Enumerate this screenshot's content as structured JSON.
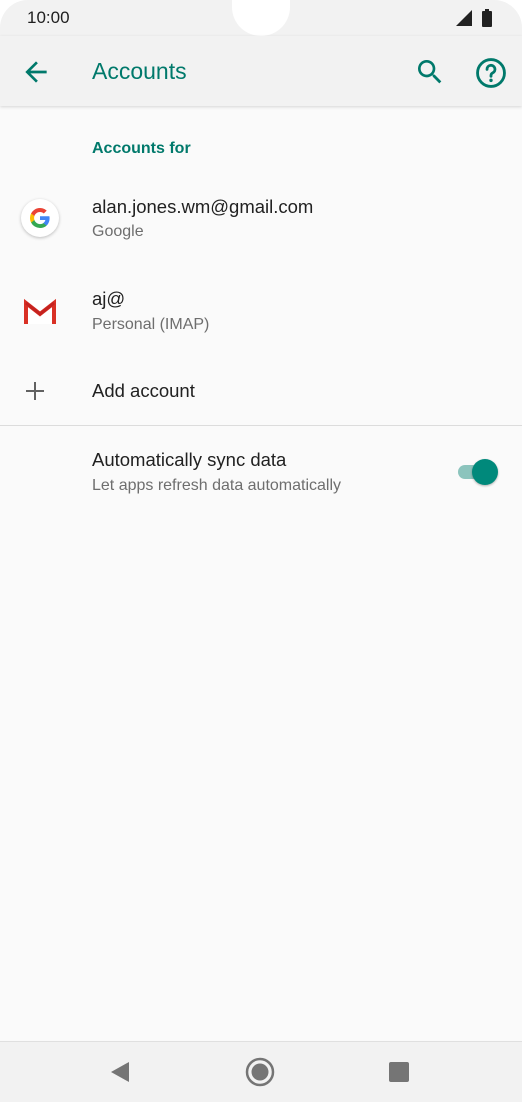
{
  "status_bar": {
    "time": "10:00"
  },
  "app_bar": {
    "title": "Accounts",
    "accent_color": "#00796b"
  },
  "section": {
    "header": "Accounts for"
  },
  "accounts": [
    {
      "email": "alan.jones.wm@gmail.com",
      "type": "Google",
      "icon": "google-icon"
    },
    {
      "email": "aj@",
      "type": "Personal (IMAP)",
      "icon": "gmail-icon"
    }
  ],
  "add_account": {
    "label": "Add account",
    "icon": "plus-icon"
  },
  "sync": {
    "title": "Automatically sync data",
    "subtitle": "Let apps refresh data automatically",
    "enabled": true
  },
  "nav_bar": {
    "icons": [
      "back-triangle-icon",
      "home-circle-icon",
      "recents-square-icon"
    ]
  }
}
